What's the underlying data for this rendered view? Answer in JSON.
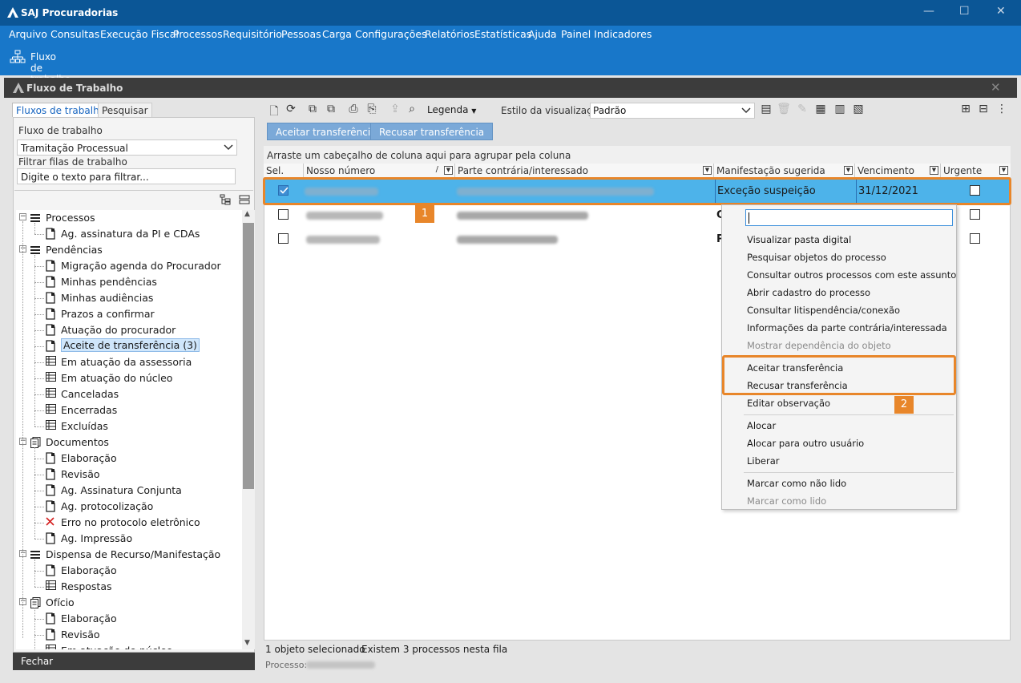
{
  "app": {
    "title": "SAJ Procuradorias"
  },
  "menu": [
    "Arquivo",
    "Consultas",
    "Execução Fiscal",
    "Processos",
    "Requisitório",
    "Pessoas",
    "Carga",
    "Configurações",
    "Relatórios",
    "Estatísticas",
    "Ajuda",
    "Painel Indicadores"
  ],
  "toolbar": {
    "workflow_button": "Fluxo de trabalho"
  },
  "inner_window": {
    "title": "Fluxo de Trabalho"
  },
  "left": {
    "tabs": [
      "Fluxos de trabalho",
      "Pesquisar"
    ],
    "workflow_label": "Fluxo de trabalho",
    "workflow_value": "Tramitação Processual",
    "filter_label": "Filtrar filas de trabalho",
    "filter_placeholder": "Digite o texto para filtrar...",
    "tree": [
      {
        "label": "Processos",
        "level": 0,
        "icon": "list-icon"
      },
      {
        "label": "Ag. assinatura da PI e CDAs",
        "level": 1,
        "icon": "document-icon"
      },
      {
        "label": "Pendências",
        "level": 0,
        "icon": "list-icon"
      },
      {
        "label": "Migração agenda do Procurador",
        "level": 1,
        "icon": "document-icon"
      },
      {
        "label": "Minhas pendências",
        "level": 1,
        "icon": "document-icon"
      },
      {
        "label": "Minhas audiências",
        "level": 1,
        "icon": "document-icon"
      },
      {
        "label": "Prazos a confirmar",
        "level": 1,
        "icon": "document-icon"
      },
      {
        "label": "Atuação do procurador",
        "level": 1,
        "icon": "document-icon"
      },
      {
        "label": "Aceite de transferência (3)",
        "level": 1,
        "icon": "document-icon",
        "selected": true
      },
      {
        "label": "Em atuação da assessoria",
        "level": 1,
        "icon": "table-icon"
      },
      {
        "label": "Em atuação do núcleo",
        "level": 1,
        "icon": "table-icon"
      },
      {
        "label": "Canceladas",
        "level": 1,
        "icon": "table-icon"
      },
      {
        "label": "Encerradas",
        "level": 1,
        "icon": "table-icon"
      },
      {
        "label": "Excluídas",
        "level": 1,
        "icon": "table-icon"
      },
      {
        "label": "Documentos",
        "level": 0,
        "icon": "documents-icon"
      },
      {
        "label": "Elaboração",
        "level": 1,
        "icon": "document-icon"
      },
      {
        "label": "Revisão",
        "level": 1,
        "icon": "document-icon"
      },
      {
        "label": "Ag. Assinatura Conjunta",
        "level": 1,
        "icon": "document-icon"
      },
      {
        "label": "Ag. protocolização",
        "level": 1,
        "icon": "document-icon"
      },
      {
        "label": "Erro no protocolo eletrônico",
        "level": 1,
        "icon": "error-x-icon"
      },
      {
        "label": "Ag. Impressão",
        "level": 1,
        "icon": "document-icon"
      },
      {
        "label": "Dispensa de Recurso/Manifestação",
        "level": 0,
        "icon": "list-icon"
      },
      {
        "label": "Elaboração",
        "level": 1,
        "icon": "document-icon"
      },
      {
        "label": "Respostas",
        "level": 1,
        "icon": "table-icon"
      },
      {
        "label": "Ofício",
        "level": 0,
        "icon": "documents-icon"
      },
      {
        "label": "Elaboração",
        "level": 1,
        "icon": "document-icon"
      },
      {
        "label": "Revisão",
        "level": 1,
        "icon": "document-icon"
      },
      {
        "label": "Em atuação do núcleo",
        "level": 1,
        "icon": "table-icon"
      }
    ],
    "close_button": "Fechar"
  },
  "right": {
    "legend_label": "Legenda",
    "view_style_label": "Estilo da visualização",
    "view_style_value": "Padrão",
    "accept_button": "Aceitar transferência",
    "reject_button": "Recusar transferência",
    "group_hint": "Arraste um cabeçalho de coluna aqui para agrupar pela coluna",
    "columns": [
      "Sel.",
      "Nosso número",
      "Parte contrária/interessado",
      "Manifestação sugerida",
      "Vencimento",
      "Urgente"
    ],
    "rows": [
      {
        "selected": true,
        "manifestacao": "Exceção suspeição",
        "vencimento": "31/12/2021",
        "manifestacao_partial": ""
      },
      {
        "selected": false,
        "manifestacao": "",
        "vencimento": "",
        "manifestacao_partial": "C"
      },
      {
        "selected": false,
        "manifestacao": "",
        "vencimento": "",
        "manifestacao_partial": "P"
      }
    ],
    "badge1": "1",
    "badge2": "2"
  },
  "context_menu": {
    "items": [
      {
        "label": "Visualizar pasta digital",
        "enabled": true
      },
      {
        "label": "Pesquisar objetos do processo",
        "enabled": true
      },
      {
        "label": "Consultar outros processos com este assunto",
        "enabled": true
      },
      {
        "label": "Abrir cadastro do processo",
        "enabled": true
      },
      {
        "label": "Consultar litispendência/conexão",
        "enabled": true
      },
      {
        "label": "Informações da parte contrária/interessada",
        "enabled": true
      },
      {
        "label": "Mostrar dependência do objeto",
        "enabled": false
      },
      {
        "label": "Aceitar transferência",
        "enabled": true
      },
      {
        "label": "Recusar transferência",
        "enabled": true
      },
      {
        "label": "Editar observação",
        "enabled": true
      },
      {
        "label": "Alocar",
        "enabled": true
      },
      {
        "label": "Alocar para outro usuário",
        "enabled": true
      },
      {
        "label": "Liberar",
        "enabled": true
      },
      {
        "label": "Marcar como não lido",
        "enabled": true
      },
      {
        "label": "Marcar como lido",
        "enabled": false
      }
    ]
  },
  "status": {
    "selected": "1 objeto selecionado",
    "count": "Existem 3 processos nesta fila",
    "process_label": "Processo:"
  },
  "colors": {
    "titlebar": "#0b5696",
    "menubar": "#1877c9",
    "selection": "#4db3ea",
    "highlight": "#e8862a"
  }
}
